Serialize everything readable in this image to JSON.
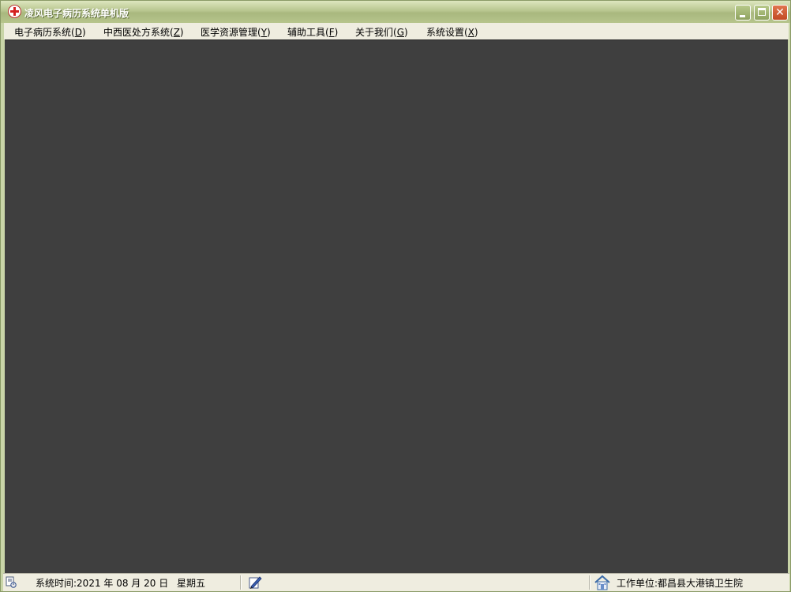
{
  "window": {
    "title": "凌风电子病历系统单机版"
  },
  "menu": {
    "items": [
      {
        "label": "电子病历系统(D)",
        "text": "电子病历系统(",
        "key": "D",
        "end": ")"
      },
      {
        "label": "中西医处方系统(Z)",
        "text": "中西医处方系统(",
        "key": "Z",
        "end": ")"
      },
      {
        "label": "医学资源管理(Y)",
        "text": "医学资源管理(",
        "key": "Y",
        "end": ")"
      },
      {
        "label": "辅助工具(F)",
        "text": "辅助工具(",
        "key": "F",
        "end": ")"
      },
      {
        "label": "关于我们(G)",
        "text": "关于我们(",
        "key": "G",
        "end": ")"
      },
      {
        "label": "系统设置(X)",
        "text": "系统设置(",
        "key": "X",
        "end": ")"
      }
    ]
  },
  "status": {
    "system_time": "系统时间:2021 年 08 月 20 日",
    "weekday": "星期五",
    "work_unit": "工作单位:都昌县大港镇卫生院"
  },
  "colors": {
    "client_bg": "#3f3f3f",
    "titlebar": "#b8c68f",
    "menubar": "#efede0"
  }
}
